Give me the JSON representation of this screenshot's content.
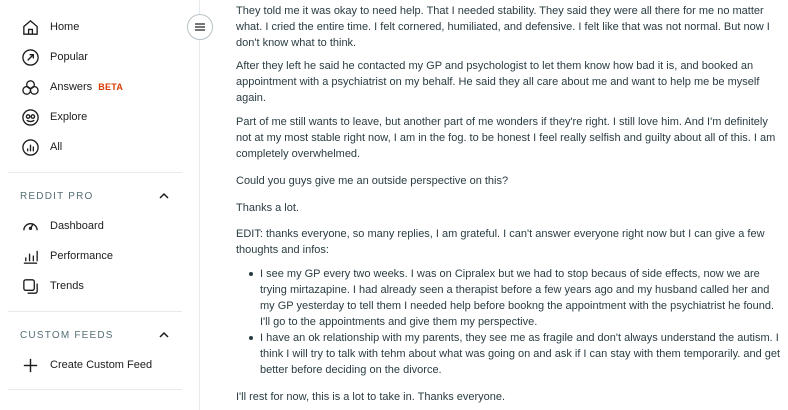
{
  "sidebar": {
    "main_items": [
      {
        "label": "Home",
        "icon": "home-icon"
      },
      {
        "label": "Popular",
        "icon": "popular-icon"
      },
      {
        "label": "Answers",
        "icon": "answers-icon",
        "badge": "BETA"
      },
      {
        "label": "Explore",
        "icon": "explore-icon"
      },
      {
        "label": "All",
        "icon": "all-icon"
      }
    ],
    "reddit_pro": {
      "title": "REDDIT PRO",
      "items": [
        {
          "label": "Dashboard",
          "icon": "dashboard-icon"
        },
        {
          "label": "Performance",
          "icon": "performance-icon"
        },
        {
          "label": "Trends",
          "icon": "trends-icon"
        }
      ]
    },
    "custom_feeds": {
      "title": "CUSTOM FEEDS",
      "items": [
        {
          "label": "Create Custom Feed",
          "icon": "plus-icon"
        }
      ]
    }
  },
  "colors": {
    "beta": "#d93a00",
    "section_title": "#576f76",
    "body_text": "#2a3c42"
  },
  "post": {
    "paragraphs": [
      "They told me it was okay to need help. That I needed stability. They said they were all there for me no matter what. I cried the entire time. I felt cornered, humiliated, and defensive. I felt like that was not normal. But now I don't know what to think.",
      "After they left he said he contacted my GP and psychologist to let them know how bad it is, and booked an appointment with a psychiatrist on my behalf. He said they all care about me and want to help me be myself again.",
      "Part of me still wants to leave, but another part of me wonders if they're right. I still love him. And I'm definitely not at my most stable right now, I am in the fog. to be honest I feel really selfish and guilty about all of this. I am completely overwhelmed.",
      "Could you guys give me an outside perspective on this?",
      "Thanks a lot.",
      "EDIT: thanks everyone, so many replies, I am grateful. I can't answer everyone right now but I can give a few thoughts and infos:"
    ],
    "bullets": [
      "I see my GP every two weeks. I was on Cipralex but we had to stop becaus of side effects, now we are trying mirtazapine. I had already seen a therapist before a few years ago and my husband called her and my GP yesterday to tell them I needed help before bookng the appointment with the psychiatrist he found. I'll go to the appointments and give them my perspective.",
      "I have an ok relationship with my parents, they see me as fragile and don't always understand the autism. I think I will try to talk with tehm about what was going on and ask if I can stay with them temporarily. and get better before deciding on the divorce."
    ],
    "closing": "I'll rest for now, this is a lot to take in. Thanks everyone."
  }
}
